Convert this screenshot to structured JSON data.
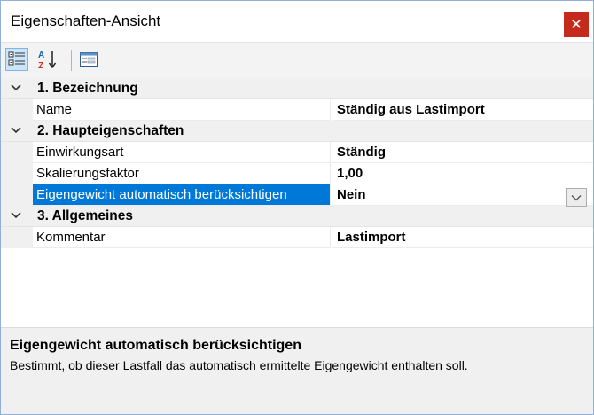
{
  "window": {
    "title": "Eigenschaften-Ansicht",
    "close_glyph": "✕"
  },
  "toolbar": {
    "buttons": [
      {
        "name": "categorized-view-button",
        "icon": "categorized-icon",
        "active": true
      },
      {
        "name": "sort-alphabetical-button",
        "icon": "sort-az-icon",
        "active": false
      },
      {
        "name": "property-pages-button",
        "icon": "property-pages-icon",
        "active": false
      }
    ]
  },
  "grid": {
    "categories": [
      {
        "label": "1. Bezeichnung",
        "expanded": true,
        "properties": [
          {
            "name": "Name",
            "value": "Ständig aus Lastimport"
          }
        ]
      },
      {
        "label": "2. Haupteigenschaften",
        "expanded": true,
        "properties": [
          {
            "name": "Einwirkungsart",
            "value": "Ständig"
          },
          {
            "name": "Skalierungsfaktor",
            "value": "1,00"
          },
          {
            "name": "Eigengewicht automatisch berücksichtigen",
            "value": "Nein",
            "selected": true
          }
        ]
      },
      {
        "label": "3. Allgemeines",
        "expanded": true,
        "properties": [
          {
            "name": "Kommentar",
            "value": "Lastimport"
          }
        ]
      }
    ]
  },
  "description": {
    "title": "Eigengewicht automatisch berücksichtigen",
    "text": "Bestimmt, ob dieser Lastfall das automatisch ermittelte Eigengewicht enthalten soll."
  },
  "colors": {
    "selection": "#0078d7",
    "close_button": "#c42b1c",
    "category_bg": "#f0f0f0"
  }
}
